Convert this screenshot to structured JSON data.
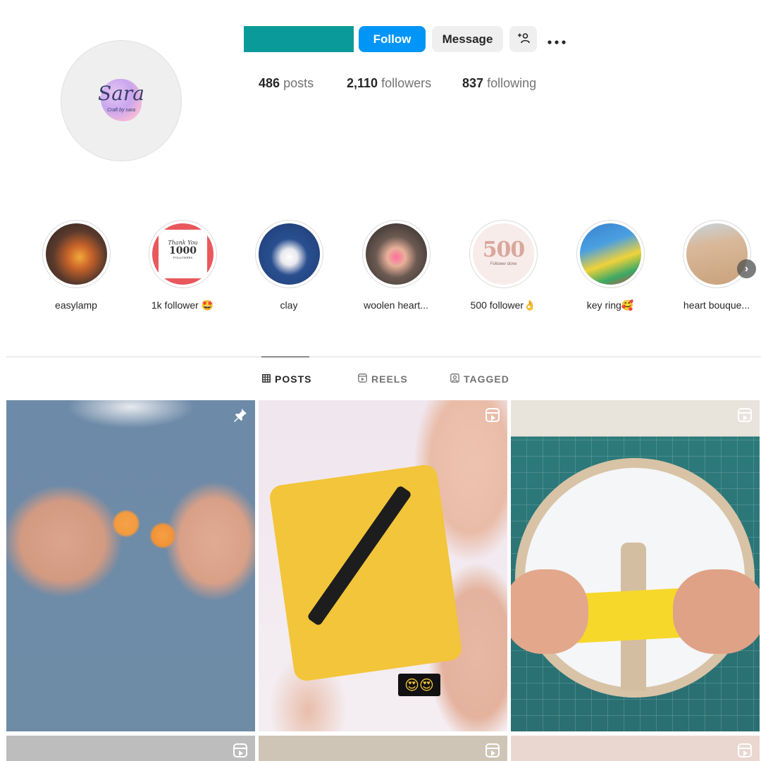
{
  "profile": {
    "avatar_text": "Sara",
    "avatar_subtext": "Craft by sara",
    "follow_label": "Follow",
    "message_label": "Message",
    "adduser_icon": "add-user-icon",
    "more_icon": "more-icon",
    "stats": {
      "posts_count": "486",
      "posts_label": "posts",
      "followers_count": "2,110",
      "followers_label": "followers",
      "following_count": "837",
      "following_label": "following"
    }
  },
  "highlights": [
    {
      "label": "easylamp"
    },
    {
      "label": "1k follower 🤩"
    },
    {
      "label": "clay"
    },
    {
      "label": "woolen heart..."
    },
    {
      "label": "500 follower👌"
    },
    {
      "label": "key ring🥰"
    },
    {
      "label": "heart bouque..."
    }
  ],
  "highlight_thumb_text": {
    "h2_script": "Thank You",
    "h2_number": "1000",
    "h2_small": "FOLLOWERS",
    "h5_number": "500",
    "h5_script": "Follower done"
  },
  "tabs": [
    {
      "label": "POSTS",
      "icon": "grid-icon",
      "active": true
    },
    {
      "label": "REELS",
      "icon": "reels-icon",
      "active": false
    },
    {
      "label": "TAGGED",
      "icon": "tagged-icon",
      "active": false
    }
  ],
  "posts": [
    {
      "type": "pinned",
      "badge_icon": "pin-icon"
    },
    {
      "type": "reel",
      "badge_icon": "reel-icon",
      "overlay": "😍😍"
    },
    {
      "type": "reel",
      "badge_icon": "reel-icon"
    },
    {
      "type": "reel",
      "badge_icon": "reel-icon"
    },
    {
      "type": "reel",
      "badge_icon": "reel-icon"
    },
    {
      "type": "reel",
      "badge_icon": "reel-icon"
    }
  ],
  "colors": {
    "follow_button": "#0095f6",
    "username_block": "#0b9a9a",
    "secondary_button": "#efefef"
  }
}
